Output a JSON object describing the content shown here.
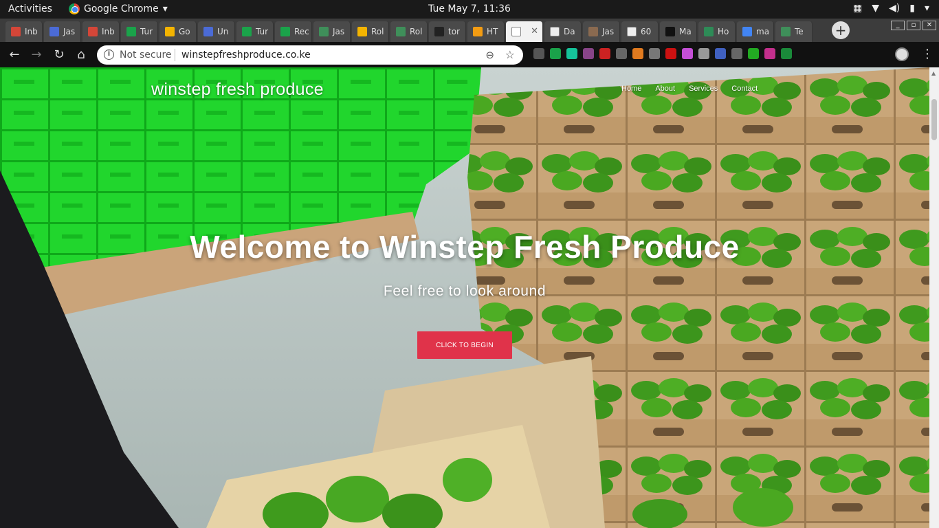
{
  "desktop": {
    "activities_label": "Activities",
    "app_menu_label": "Google Chrome",
    "app_menu_arrow": "▾",
    "clock": "Tue May  7, 11:36",
    "tray": [
      "▦",
      "▼",
      "◀)",
      "▮",
      "▾"
    ]
  },
  "browser": {
    "tabs": [
      {
        "label": "Inb",
        "icon": "gmail-icon",
        "color": "#d44638"
      },
      {
        "label": "Jas",
        "icon": "docs-icon",
        "color": "#4b6bd6"
      },
      {
        "label": "Inb",
        "icon": "gmail-icon",
        "color": "#d44638"
      },
      {
        "label": "Tur",
        "icon": "turnitin-icon",
        "color": "#1aa34a"
      },
      {
        "label": "Go",
        "icon": "drive-icon",
        "color": "#f4b400"
      },
      {
        "label": "Un",
        "icon": "docs-icon",
        "color": "#4b6bd6"
      },
      {
        "label": "Tur",
        "icon": "turnitin-icon",
        "color": "#1aa34a"
      },
      {
        "label": "Rec",
        "icon": "turnitin-icon",
        "color": "#1aa34a"
      },
      {
        "label": "Jas",
        "icon": "tower-icon",
        "color": "#3f8f5a"
      },
      {
        "label": "Rol",
        "icon": "slides-icon",
        "color": "#f4b400"
      },
      {
        "label": "Rol",
        "icon": "tower-icon",
        "color": "#3f8f5a"
      },
      {
        "label": "tor",
        "icon": "github-icon",
        "color": "#222222"
      },
      {
        "label": "HT",
        "icon": "html-icon",
        "color": "#f39c12"
      },
      {
        "label": "",
        "icon": "page-icon",
        "color": "#ffffff",
        "active": true,
        "close": "✕"
      },
      {
        "label": "Da",
        "icon": "page-icon",
        "color": "#eeeeee"
      },
      {
        "label": "Jas",
        "icon": "avatar-icon",
        "color": "#8a6a50"
      },
      {
        "label": "60",
        "icon": "page-icon",
        "color": "#eeeeee"
      },
      {
        "label": "Ma",
        "icon": "mendeley-icon",
        "color": "#111111"
      },
      {
        "label": "Ho",
        "icon": "diamond-icon",
        "color": "#2e8b57"
      },
      {
        "label": "ma",
        "icon": "google-icon",
        "color": "#4285f4"
      },
      {
        "label": "Te",
        "icon": "tower-icon",
        "color": "#3f8f5a"
      }
    ],
    "new_tab": "+",
    "window_controls": [
      "_",
      "▫",
      "✕"
    ],
    "nav": {
      "back": "←",
      "forward": "→",
      "reload": "↻",
      "home": "⌂"
    },
    "omnibox": {
      "info_glyph": "i",
      "security_label": "Not secure",
      "url": "winstepfreshproduce.co.ke",
      "zoom_glyph": "⊖",
      "star_glyph": "☆"
    },
    "menu_glyph": "⋮",
    "extension_colors": [
      "#555555",
      "#1aa34a",
      "#15c39a",
      "#884488",
      "#cc2222",
      "#666666",
      "#e07a1f",
      "#777777",
      "#cc1111",
      "#c44fd6",
      "#999999",
      "#4060c0",
      "#666666",
      "#22aa22",
      "#c32f8c",
      "#1a8a3a"
    ]
  },
  "site": {
    "brand": "winstep fresh produce",
    "nav": [
      "Home",
      "About",
      "Services",
      "Contact"
    ],
    "hero_title": "Welcome to Winstep Fresh Produce",
    "hero_subtitle": "Feel free to look around",
    "cta_label": "CLICK TO BEGIN",
    "accent": "#e0334a"
  }
}
